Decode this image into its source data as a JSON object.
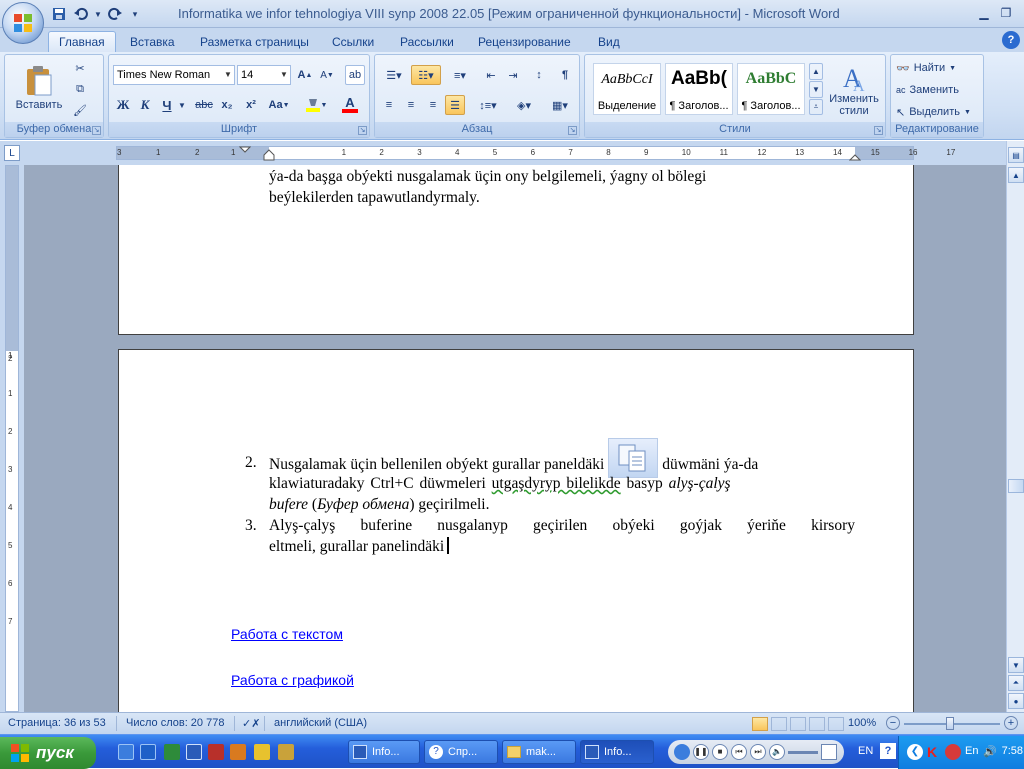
{
  "window": {
    "title": "Informatika we infor tehnologiya VIII synp 2008 22.05 [Режим ограниченной функциональности] - Microsoft Word"
  },
  "tabs": [
    "Главная",
    "Вставка",
    "Разметка страницы",
    "Ссылки",
    "Рассылки",
    "Рецензирование",
    "Вид"
  ],
  "ribbon": {
    "clipboard": {
      "paste_label": "Вставить",
      "group_label": "Буфер обмена"
    },
    "font": {
      "font_name": "Times New Roman",
      "font_size": "14",
      "bold": "Ж",
      "italic": "К",
      "underline": "Ч",
      "strike": "abc",
      "subscript": "x₂",
      "superscript": "x²",
      "case": "Aa",
      "grow": "A",
      "shrink": "A",
      "font_color_letter": "A",
      "group_label": "Шрифт"
    },
    "paragraph": {
      "group_label": "Абзац"
    },
    "styles": {
      "group_label": "Стили",
      "tiles": [
        {
          "sample": "AaBbCcI",
          "name": "Выделение"
        },
        {
          "sample": "AaBb(",
          "name": "¶ Заголов..."
        },
        {
          "sample": "AaBbC",
          "name": "¶ Заголов..."
        }
      ],
      "change_label_1": "Изменить",
      "change_label_2": "стили"
    },
    "editing": {
      "group_label": "Редактирование",
      "find": "Найти",
      "replace": "Заменить",
      "select": "Выделить"
    }
  },
  "ruler": {
    "h_ticks": [
      "3",
      "1",
      "2",
      "1",
      "1",
      "2",
      "3",
      "4",
      "5",
      "6",
      "7",
      "8",
      "9",
      "10",
      "11",
      "12",
      "13",
      "14",
      "15",
      "16",
      "17"
    ],
    "v_ticks": [
      "2",
      "1",
      "1",
      "2",
      "3",
      "4",
      "5",
      "6",
      "7"
    ]
  },
  "document": {
    "page1_lines": [
      "ýa-da başga obýekti nusgalamak üçin ony belgilemeli, ýagny ol bölegi",
      "beýlekilerden tapawutlandyrmaly."
    ],
    "item2": {
      "number": "2.",
      "line1_a": "Nusgalamak üçin bellenilen obýekt gurallar paneldäki",
      "line1_b": "düwmäni ýa-da",
      "line2_a": "klawiaturadaky Ctrl+C düwmeleri",
      "line2_b": "utgaşdyryp  bilelikde",
      "line2_c": "basyp",
      "line2_d": "alyş-çalyş",
      "line3_a": "bufere",
      "line3_b": "(",
      "line3_c": "Буфер обмена",
      "line3_d": ") geçirilmeli."
    },
    "item3": {
      "number": "3.",
      "line1": "Alyş-çalyş buferine nusgalanyp geçirilen obýeki goýjak ýeriňe kirsory",
      "line2": "eltmeli, gurallar panelindäki"
    },
    "links": [
      "Работа с текстом",
      "Работа с графикой"
    ]
  },
  "status": {
    "page": "Страница: 36 из 53",
    "words": "Число слов: 20 778",
    "language": "английский (США)",
    "zoom": "100%"
  },
  "taskbar": {
    "start": "пуск",
    "tasks": [
      "Info...",
      "Спр...",
      "mak...",
      "Info..."
    ],
    "lang": "EN",
    "lang2": "En",
    "clock": "7:58"
  }
}
